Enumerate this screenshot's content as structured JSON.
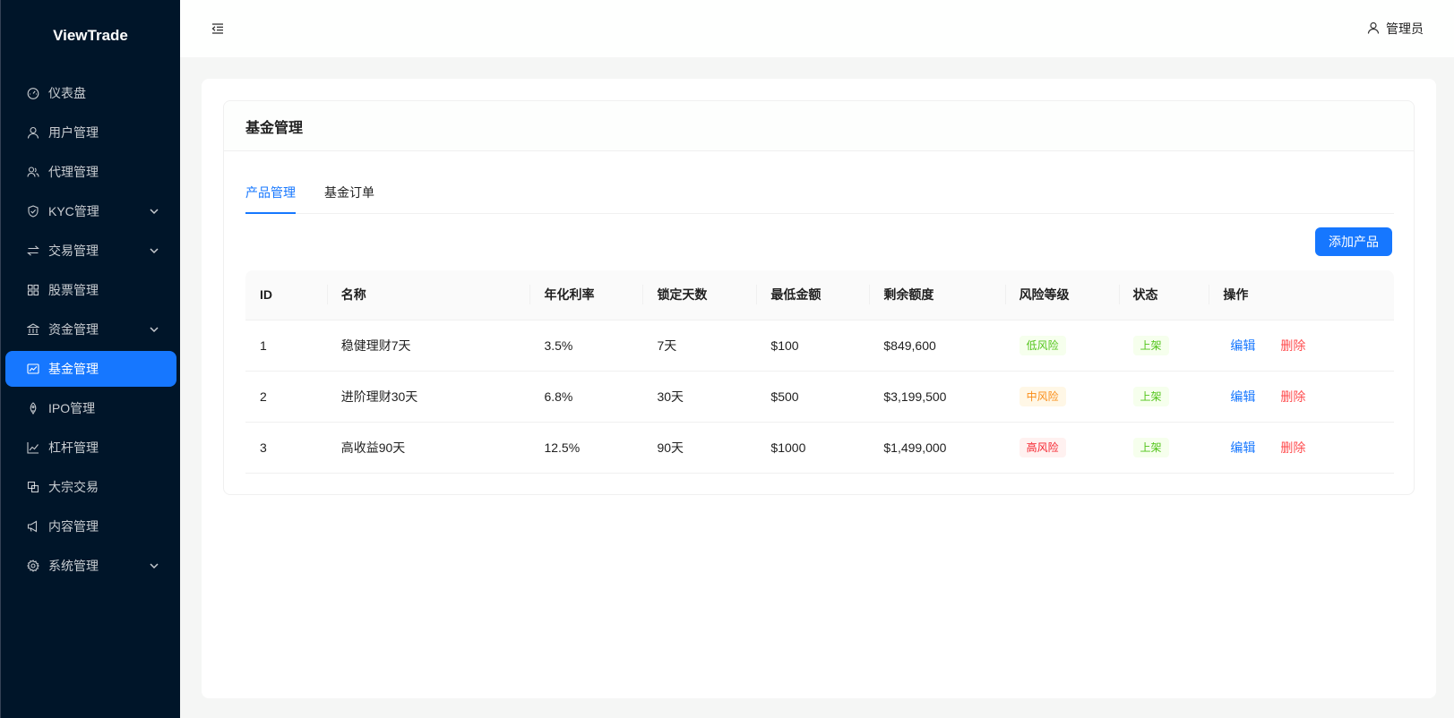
{
  "app": {
    "logo": "ViewTrade"
  },
  "header": {
    "user_name": "管理员"
  },
  "sidebar": {
    "items": [
      {
        "label": "仪表盘",
        "icon": "dashboard-icon",
        "has_submenu": false,
        "active": false
      },
      {
        "label": "用户管理",
        "icon": "user-icon",
        "has_submenu": false,
        "active": false
      },
      {
        "label": "代理管理",
        "icon": "team-icon",
        "has_submenu": false,
        "active": false
      },
      {
        "label": "KYC管理",
        "icon": "shield-icon",
        "has_submenu": true,
        "active": false
      },
      {
        "label": "交易管理",
        "icon": "swap-icon",
        "has_submenu": true,
        "active": false
      },
      {
        "label": "股票管理",
        "icon": "appstore-icon",
        "has_submenu": false,
        "active": false
      },
      {
        "label": "资金管理",
        "icon": "bank-icon",
        "has_submenu": true,
        "active": false
      },
      {
        "label": "基金管理",
        "icon": "fund-icon",
        "has_submenu": false,
        "active": true
      },
      {
        "label": "IPO管理",
        "icon": "rocket-icon",
        "has_submenu": false,
        "active": false
      },
      {
        "label": "杠杆管理",
        "icon": "line-chart-icon",
        "has_submenu": false,
        "active": false
      },
      {
        "label": "大宗交易",
        "icon": "block-icon",
        "has_submenu": false,
        "active": false
      },
      {
        "label": "内容管理",
        "icon": "notification-icon",
        "has_submenu": false,
        "active": false
      },
      {
        "label": "系统管理",
        "icon": "setting-icon",
        "has_submenu": true,
        "active": false
      }
    ]
  },
  "page": {
    "title": "基金管理",
    "tabs": [
      {
        "label": "产品管理",
        "active": true
      },
      {
        "label": "基金订单",
        "active": false
      }
    ],
    "add_button": "添加产品"
  },
  "table": {
    "columns": [
      "ID",
      "名称",
      "年化利率",
      "锁定天数",
      "最低金额",
      "剩余额度",
      "风险等级",
      "状态",
      "操作"
    ],
    "rows": [
      {
        "id": "1",
        "name": "稳健理财7天",
        "rate": "3.5%",
        "days": "7天",
        "min": "$100",
        "remaining": "$849,600",
        "risk": "低风险",
        "risk_level": "low",
        "status": "上架",
        "edit": "编辑",
        "delete": "删除"
      },
      {
        "id": "2",
        "name": "进阶理财30天",
        "rate": "6.8%",
        "days": "30天",
        "min": "$500",
        "remaining": "$3,199,500",
        "risk": "中风险",
        "risk_level": "mid",
        "status": "上架",
        "edit": "编辑",
        "delete": "删除"
      },
      {
        "id": "3",
        "name": "高收益90天",
        "rate": "12.5%",
        "days": "90天",
        "min": "$1000",
        "remaining": "$1,499,000",
        "risk": "高风险",
        "risk_level": "high",
        "status": "上架",
        "edit": "编辑",
        "delete": "删除"
      }
    ]
  },
  "colors": {
    "sidebar_bg": "#001529",
    "primary": "#1677ff",
    "danger": "#ff4d4f",
    "success": "#52c41a",
    "warning": "#fa8c16"
  }
}
